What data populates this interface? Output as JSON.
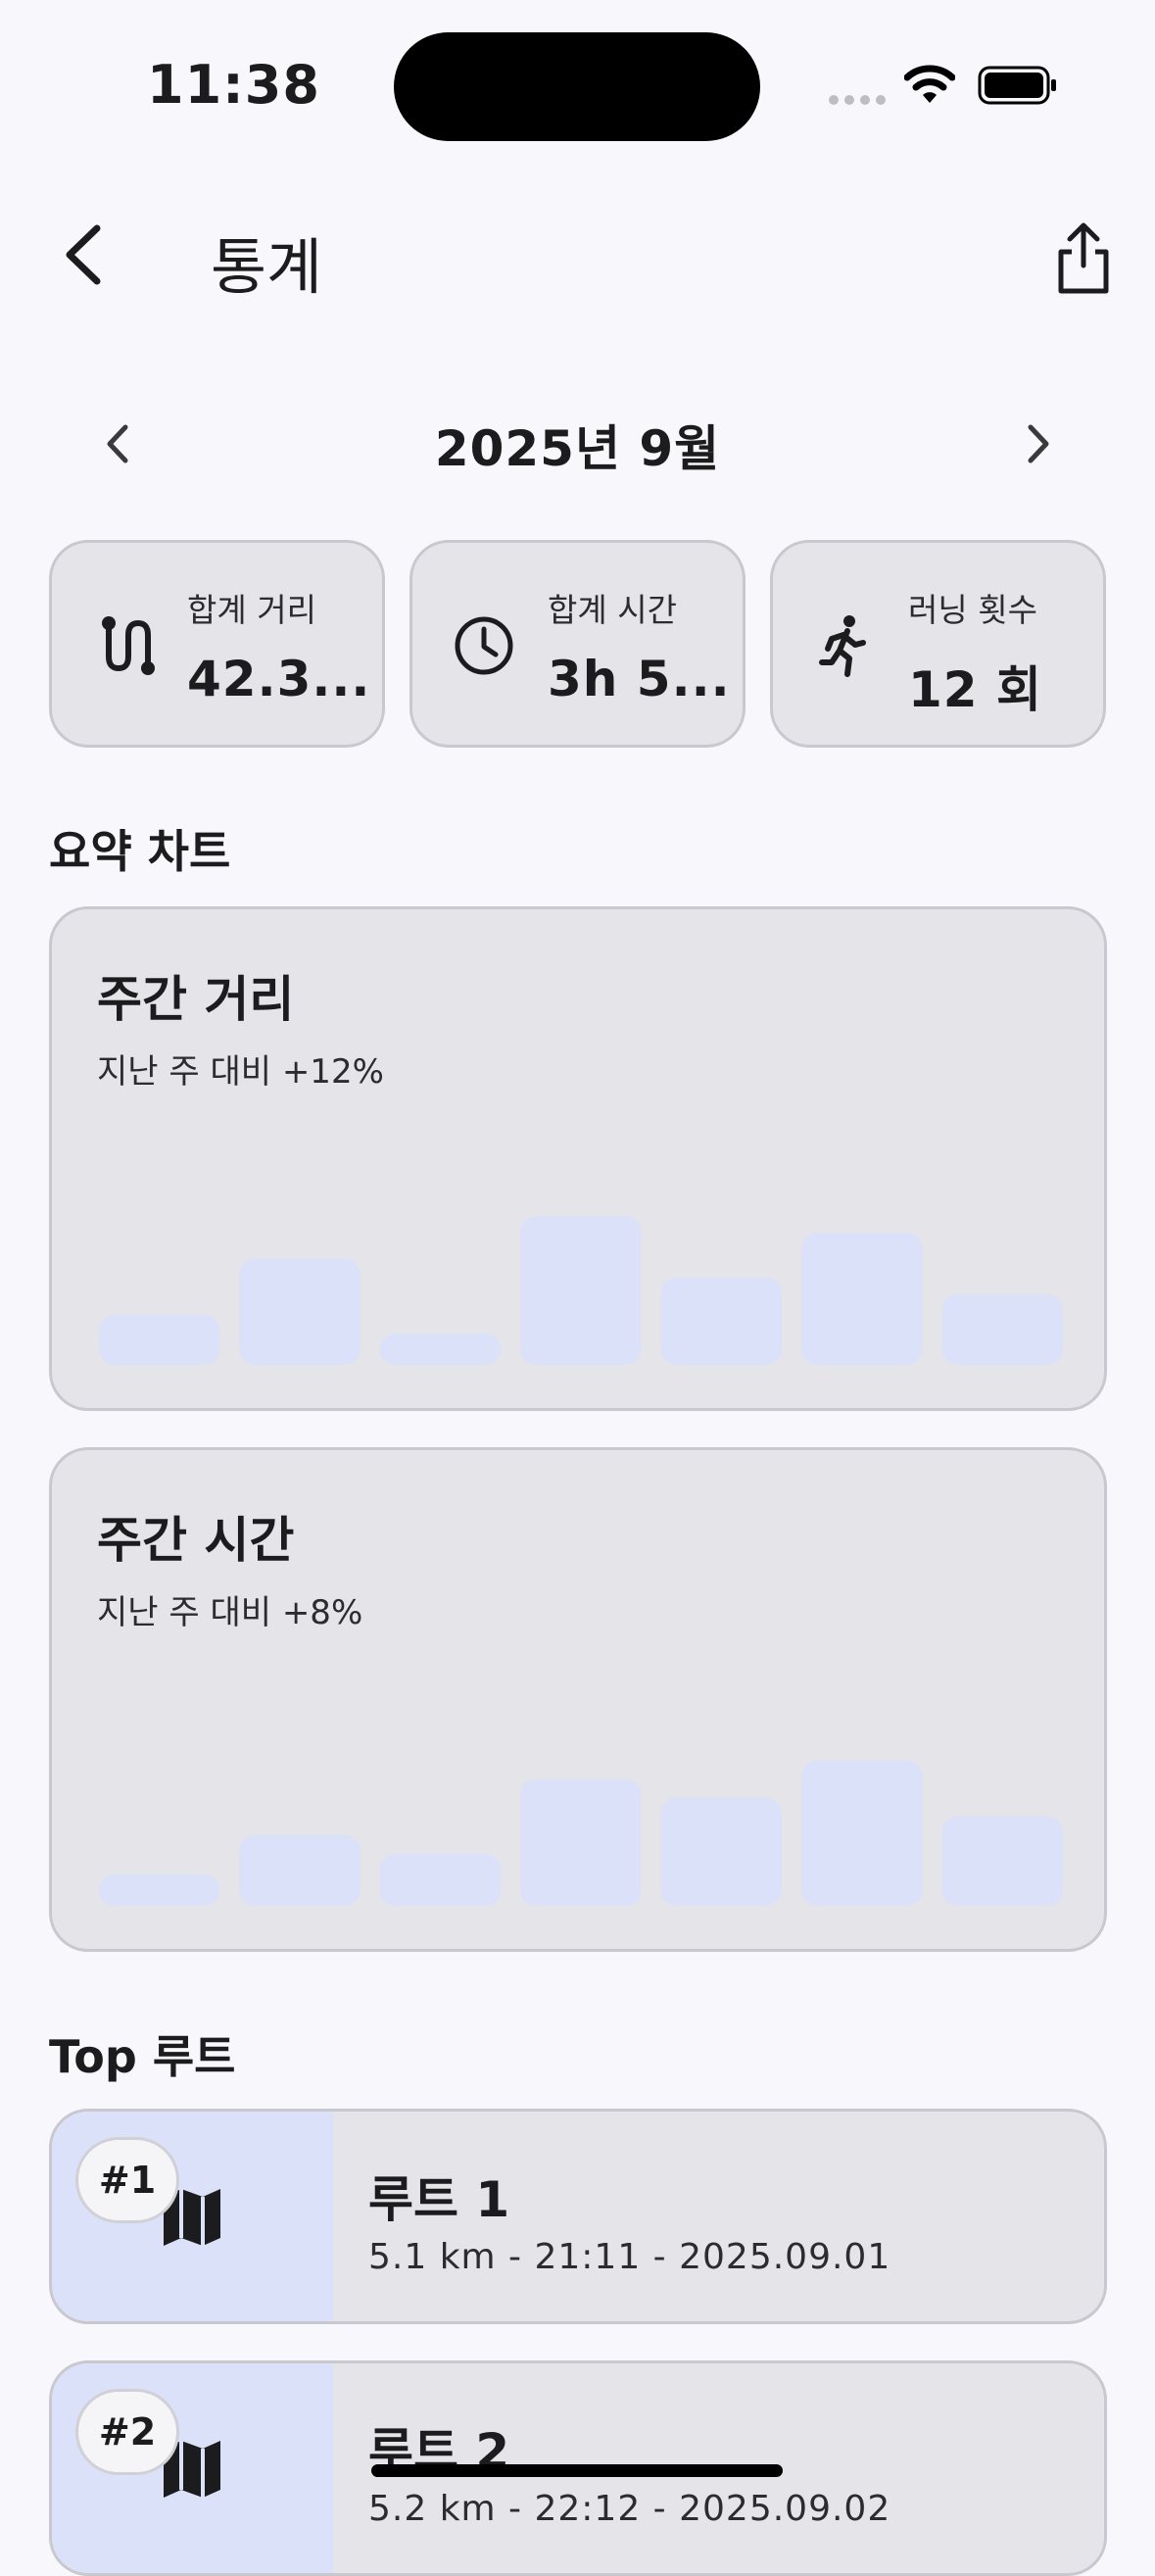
{
  "status_bar": {
    "time": "11:38"
  },
  "header": {
    "title": "통계"
  },
  "month_nav": {
    "label": "2025년 9월"
  },
  "stats": [
    {
      "icon": "route-icon",
      "label": "합계 거리",
      "value": "42.3..."
    },
    {
      "icon": "clock-icon",
      "label": "합계 시간",
      "value": "3h 5..."
    },
    {
      "icon": "runner-icon",
      "label": "러닝 횟수",
      "value": "12 회"
    }
  ],
  "summary": {
    "section_title": "요약 차트"
  },
  "chart_data": [
    {
      "type": "bar",
      "title": "주간 거리",
      "subtitle": "지난 주 대비 +12%",
      "categories": [
        "",
        "",
        "",
        "",
        "",
        "",
        ""
      ],
      "values": [
        27,
        57,
        17,
        80,
        47,
        71,
        38
      ],
      "ylim": [
        0,
        100
      ],
      "bar_color": "#DCE1FA"
    },
    {
      "type": "bar",
      "title": "주간 시간",
      "subtitle": "지난 주 대비 +8%",
      "categories": [
        "",
        "",
        "",
        "",
        "",
        "",
        ""
      ],
      "values": [
        17,
        38,
        28,
        68,
        58,
        78,
        48
      ],
      "ylim": [
        0,
        100
      ],
      "bar_color": "#DCE1FA"
    }
  ],
  "top_routes": {
    "section_title": "Top 루트",
    "items": [
      {
        "rank": "#1",
        "name": "루트 1",
        "meta": "5.1 km - 21:11 - 2025.09.01"
      },
      {
        "rank": "#2",
        "name": "루트 2",
        "meta": "5.2 km - 22:12 - 2025.09.02"
      }
    ]
  },
  "colors": {
    "background": "#F8F8FC",
    "card": "#E4E4E9",
    "accent_bar": "#DCE1FA"
  }
}
